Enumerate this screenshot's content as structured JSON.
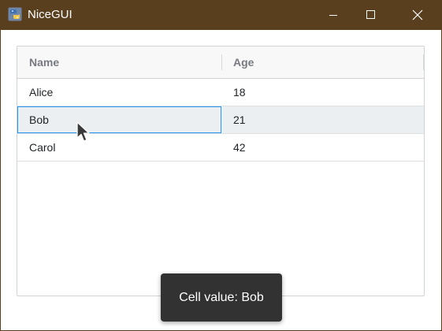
{
  "window": {
    "title": "NiceGUI",
    "titlebar_color": "#5a3f1f"
  },
  "grid": {
    "columns": [
      "Name",
      "Age"
    ],
    "rows": [
      {
        "name": "Alice",
        "age": "18"
      },
      {
        "name": "Bob",
        "age": "21"
      },
      {
        "name": "Carol",
        "age": "42"
      }
    ],
    "focused_row": 1,
    "accent_color": "#2196f3"
  },
  "toast": {
    "message": "Cell value: Bob"
  },
  "icons": {
    "app": "python-logo-icon",
    "minimize": "minimize-icon",
    "maximize": "maximize-icon",
    "close": "close-icon",
    "cursor": "mouse-pointer-icon"
  }
}
